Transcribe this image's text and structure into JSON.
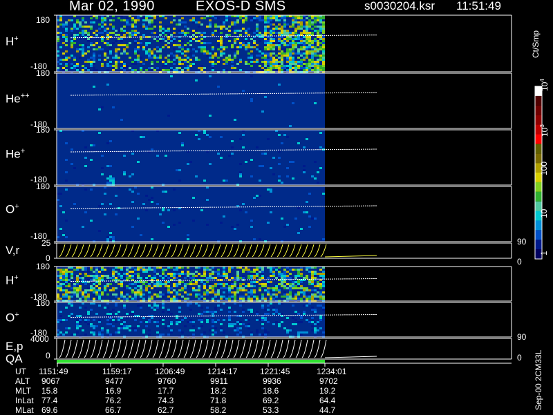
{
  "header": {
    "date": "Mar 02, 1990",
    "mission": "EXOS-D SMS",
    "file": "s0030204.ksr",
    "time": "11:51:49"
  },
  "colorbar": {
    "unit": "Ct/Smp",
    "labels": [
      "10^4",
      "10^3",
      "100",
      "10",
      "1"
    ],
    "colors": [
      "#000060",
      "#001a8c",
      "#0050c8",
      "#0090d8",
      "#00c8d0",
      "#50c8a0",
      "#30b030",
      "#80d020",
      "#d8d000",
      "#b0a000",
      "#7a6a00",
      "#606000",
      "#ff0000",
      "#c00000",
      "#900000",
      "#700000",
      "#500000",
      "#ffffff"
    ]
  },
  "version_stamp": "Sep-00 2CM33L",
  "panels": [
    {
      "id": "h-plus-top",
      "species": "H",
      "charge": "+",
      "top": "180",
      "bottom": "-180"
    },
    {
      "id": "he-plus-plus",
      "species": "He",
      "charge": "++",
      "top": "180",
      "bottom": "-180"
    },
    {
      "id": "he-plus",
      "species": "He",
      "charge": "+",
      "top": "180",
      "bottom": "-180"
    },
    {
      "id": "o-plus-top",
      "species": "O",
      "charge": "+",
      "top": "180",
      "bottom": "-180"
    },
    {
      "id": "v-r",
      "species": "V,r",
      "charge": "",
      "top": "25",
      "bottom": "0",
      "right_top": "90",
      "right_bottom": "0"
    },
    {
      "id": "h-plus-low",
      "species": "H",
      "charge": "+",
      "top": "180",
      "bottom": "-180"
    },
    {
      "id": "o-plus-low",
      "species": "O",
      "charge": "+",
      "top": "180",
      "bottom": "-180"
    },
    {
      "id": "e-p",
      "species": "E,p",
      "charge": "",
      "sublabel": "QA",
      "top": "4000",
      "bottom": "0",
      "right_top": "90",
      "right_bottom": "0"
    }
  ],
  "footer": {
    "rows": [
      {
        "name": "UT",
        "values": [
          "1151:49",
          "1159:17",
          "1206:49",
          "1214:17",
          "1221:45",
          "1234:01"
        ]
      },
      {
        "name": "ALT",
        "values": [
          "9067",
          "9477",
          "9760",
          "9911",
          "9936",
          "9702"
        ]
      },
      {
        "name": "MLT",
        "values": [
          "15.8",
          "16.9",
          "17.7",
          "18.2",
          "18.6",
          "19.2"
        ]
      },
      {
        "name": "InLat",
        "values": [
          "77.4",
          "76.2",
          "74.3",
          "71.8",
          "69.2",
          "64.4"
        ]
      },
      {
        "name": "MLat",
        "values": [
          "69.6",
          "66.7",
          "62.7",
          "58.2",
          "53.3",
          "44.7"
        ]
      }
    ]
  },
  "chart_data": {
    "type": "heatmap",
    "title": "Mar 02, 1990   EXOS-D SMS",
    "x_tick_labels": [
      "1151:49",
      "1159:17",
      "1206:49",
      "1214:17",
      "1221:45",
      "1234:01"
    ],
    "series": [
      {
        "name": "H+",
        "ylim": [
          -180,
          180
        ]
      },
      {
        "name": "He++",
        "ylim": [
          -180,
          180
        ]
      },
      {
        "name": "He+",
        "ylim": [
          -180,
          180
        ]
      },
      {
        "name": "O+",
        "ylim": [
          -180,
          180
        ]
      },
      {
        "name": "V,r",
        "ylim": [
          0,
          25
        ],
        "ylim_right": [
          0,
          90
        ]
      },
      {
        "name": "H+",
        "ylim": [
          -180,
          180
        ]
      },
      {
        "name": "O+",
        "ylim": [
          -180,
          180
        ]
      },
      {
        "name": "E,p",
        "ylim": [
          0,
          4000
        ],
        "ylim_right": [
          0,
          90
        ]
      }
    ],
    "colorbar_unit": "Ct/Smp"
  }
}
